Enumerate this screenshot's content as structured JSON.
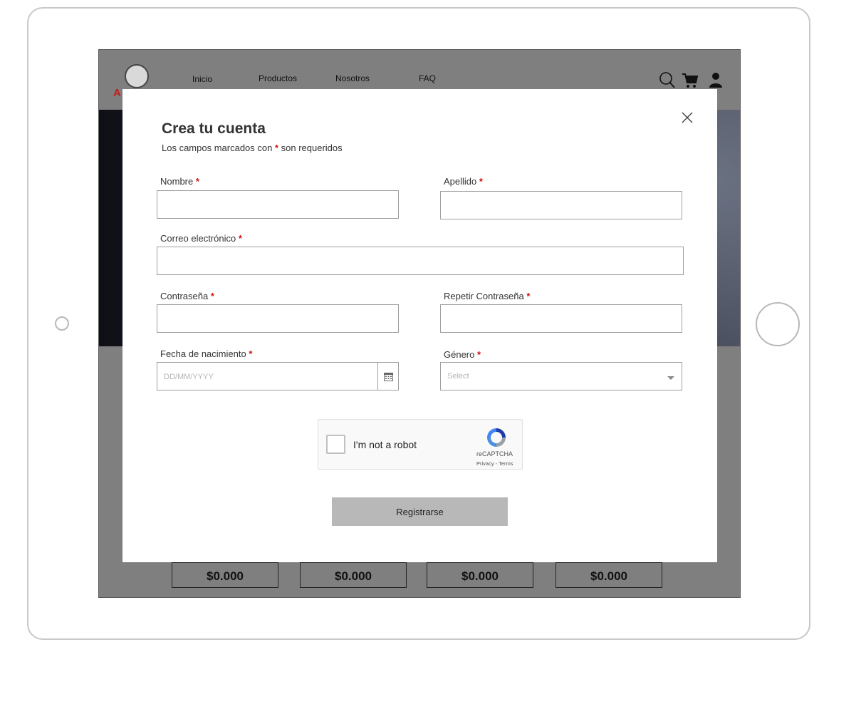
{
  "background_page": {
    "nav": {
      "logo_text": "A",
      "links": [
        "Inicio",
        "Productos",
        "Nosotros",
        "FAQ"
      ],
      "icons": [
        "search-icon",
        "cart-icon",
        "user-icon"
      ]
    },
    "prices": [
      "$0.000",
      "$0.000",
      "$0.000",
      "$0.000"
    ]
  },
  "modal": {
    "title": "Crea tu cuenta",
    "subtitle_before": "Los campos marcados con ",
    "required_mark": "*",
    "subtitle_after": " son requeridos",
    "fields": {
      "nombre": {
        "label": "Nombre",
        "value": ""
      },
      "apellido": {
        "label": "Apellido",
        "value": ""
      },
      "correo": {
        "label": "Correo electrónico",
        "value": ""
      },
      "contrasena": {
        "label": "Contraseña",
        "value": ""
      },
      "repetir": {
        "label": "Repetir Contraseña",
        "value": ""
      },
      "fecha": {
        "label": "Fecha de nacimiento",
        "placeholder": "DD/MM/YYYY",
        "value": ""
      },
      "genero": {
        "label": "Género",
        "selected": "Select"
      }
    },
    "captcha": {
      "text": "I'm not a robot",
      "brand": "reCAPTCHA",
      "terms": "Privacy - Terms"
    },
    "submit_label": "Registrarse"
  },
  "colors": {
    "required": "#d01010",
    "submit_bg": "#b8b8b8",
    "overlay": "#7f7f7f"
  }
}
